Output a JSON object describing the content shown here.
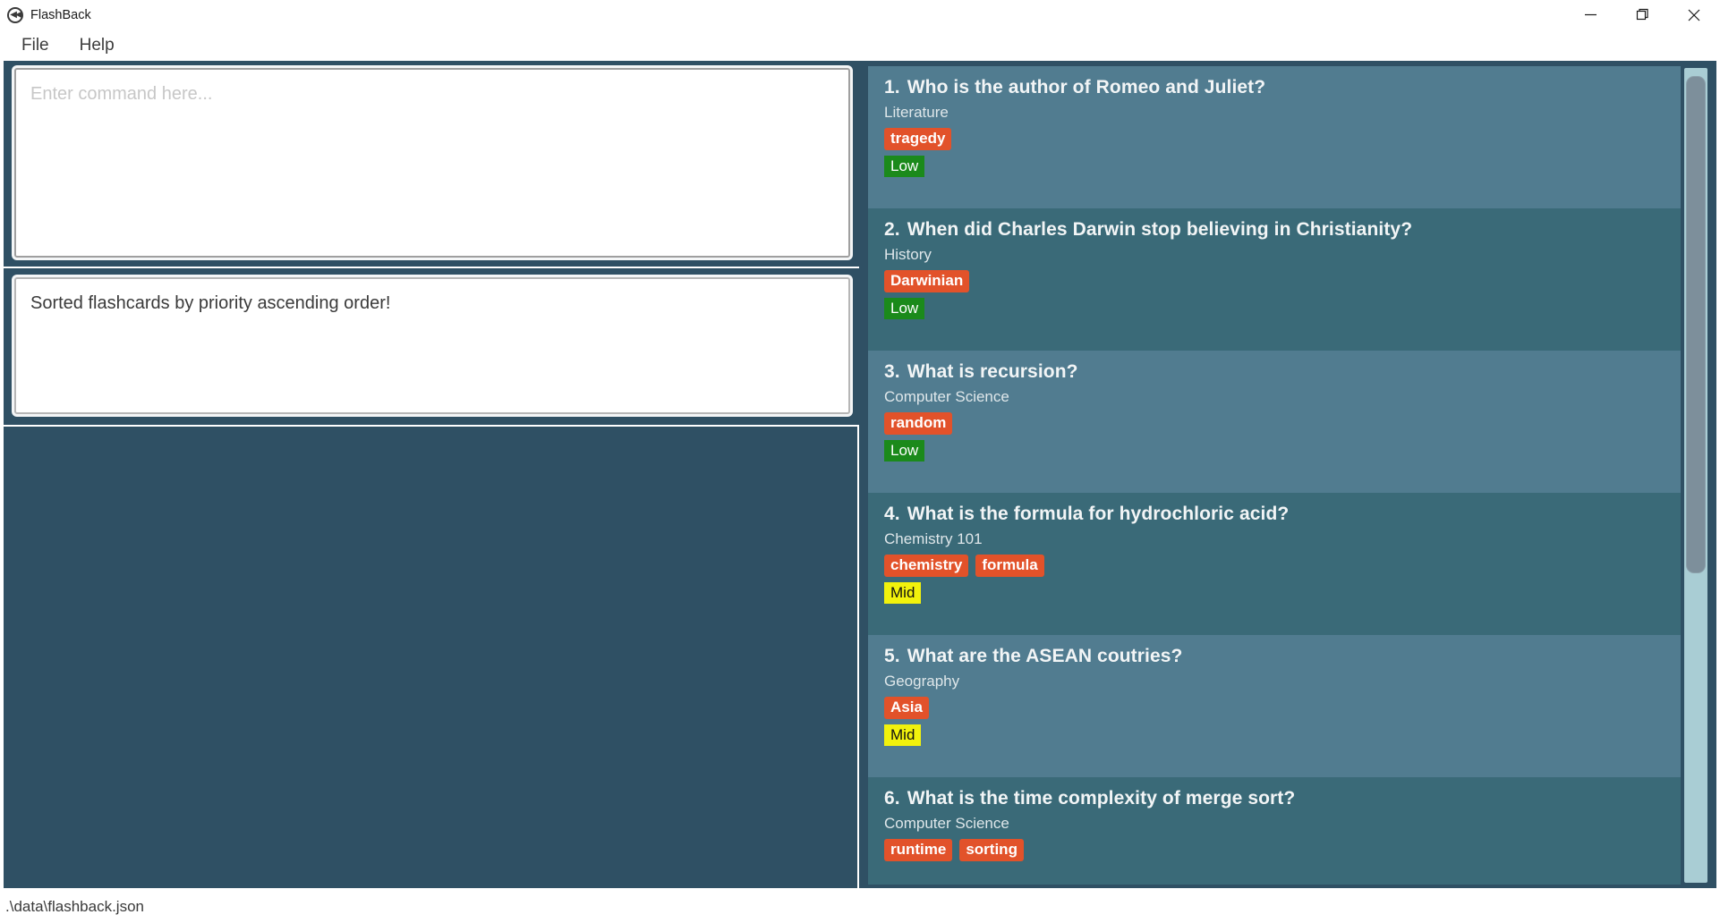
{
  "window": {
    "title": "FlashBack",
    "icon": "rewind-circle-icon",
    "controls": {
      "minimize": "minimize-icon",
      "maximize": "maximize-icon",
      "close": "close-icon"
    }
  },
  "menubar": {
    "items": [
      {
        "label": "File"
      },
      {
        "label": "Help"
      }
    ]
  },
  "command_box": {
    "placeholder": "Enter command here...",
    "value": ""
  },
  "result_box": {
    "value": "Sorted flashcards by priority ascending order!"
  },
  "statusbar": {
    "path": ".\\data\\flashback.json"
  },
  "scrollbar": {
    "orientation": "vertical",
    "thumb_position_percent": 1,
    "thumb_size_percent": 61
  },
  "colors": {
    "panel_bg": "#2f5064",
    "row_light": "#517c90",
    "row_dark": "#3a6a78",
    "tag": "#e2522a",
    "priority_low": "#1b8a1b",
    "priority_mid": "#f2f20c",
    "priority_high": "#d01010",
    "scrollbar_track": "#a9cdd4",
    "scrollbar_thumb": "#7d8f9b"
  },
  "flashcards": [
    {
      "index": "1.",
      "question": "Who is the author of Romeo and Juliet?",
      "subject": "Literature",
      "tags": [
        "tragedy"
      ],
      "priority": "Low"
    },
    {
      "index": "2.",
      "question": "When did Charles Darwin stop believing in Christianity?",
      "subject": "History",
      "tags": [
        "Darwinian"
      ],
      "priority": "Low"
    },
    {
      "index": "3.",
      "question": "What is recursion?",
      "subject": "Computer Science",
      "tags": [
        "random"
      ],
      "priority": "Low"
    },
    {
      "index": "4.",
      "question": "What is the formula for hydrochloric acid?",
      "subject": "Chemistry 101",
      "tags": [
        "chemistry",
        "formula"
      ],
      "priority": "Mid"
    },
    {
      "index": "5.",
      "question": "What are the ASEAN coutries?",
      "subject": "Geography",
      "tags": [
        "Asia"
      ],
      "priority": "Mid"
    },
    {
      "index": "6.",
      "question": "What is the time complexity of merge sort?",
      "subject": "Computer Science",
      "tags": [
        "runtime",
        "sorting"
      ],
      "priority": ""
    }
  ]
}
